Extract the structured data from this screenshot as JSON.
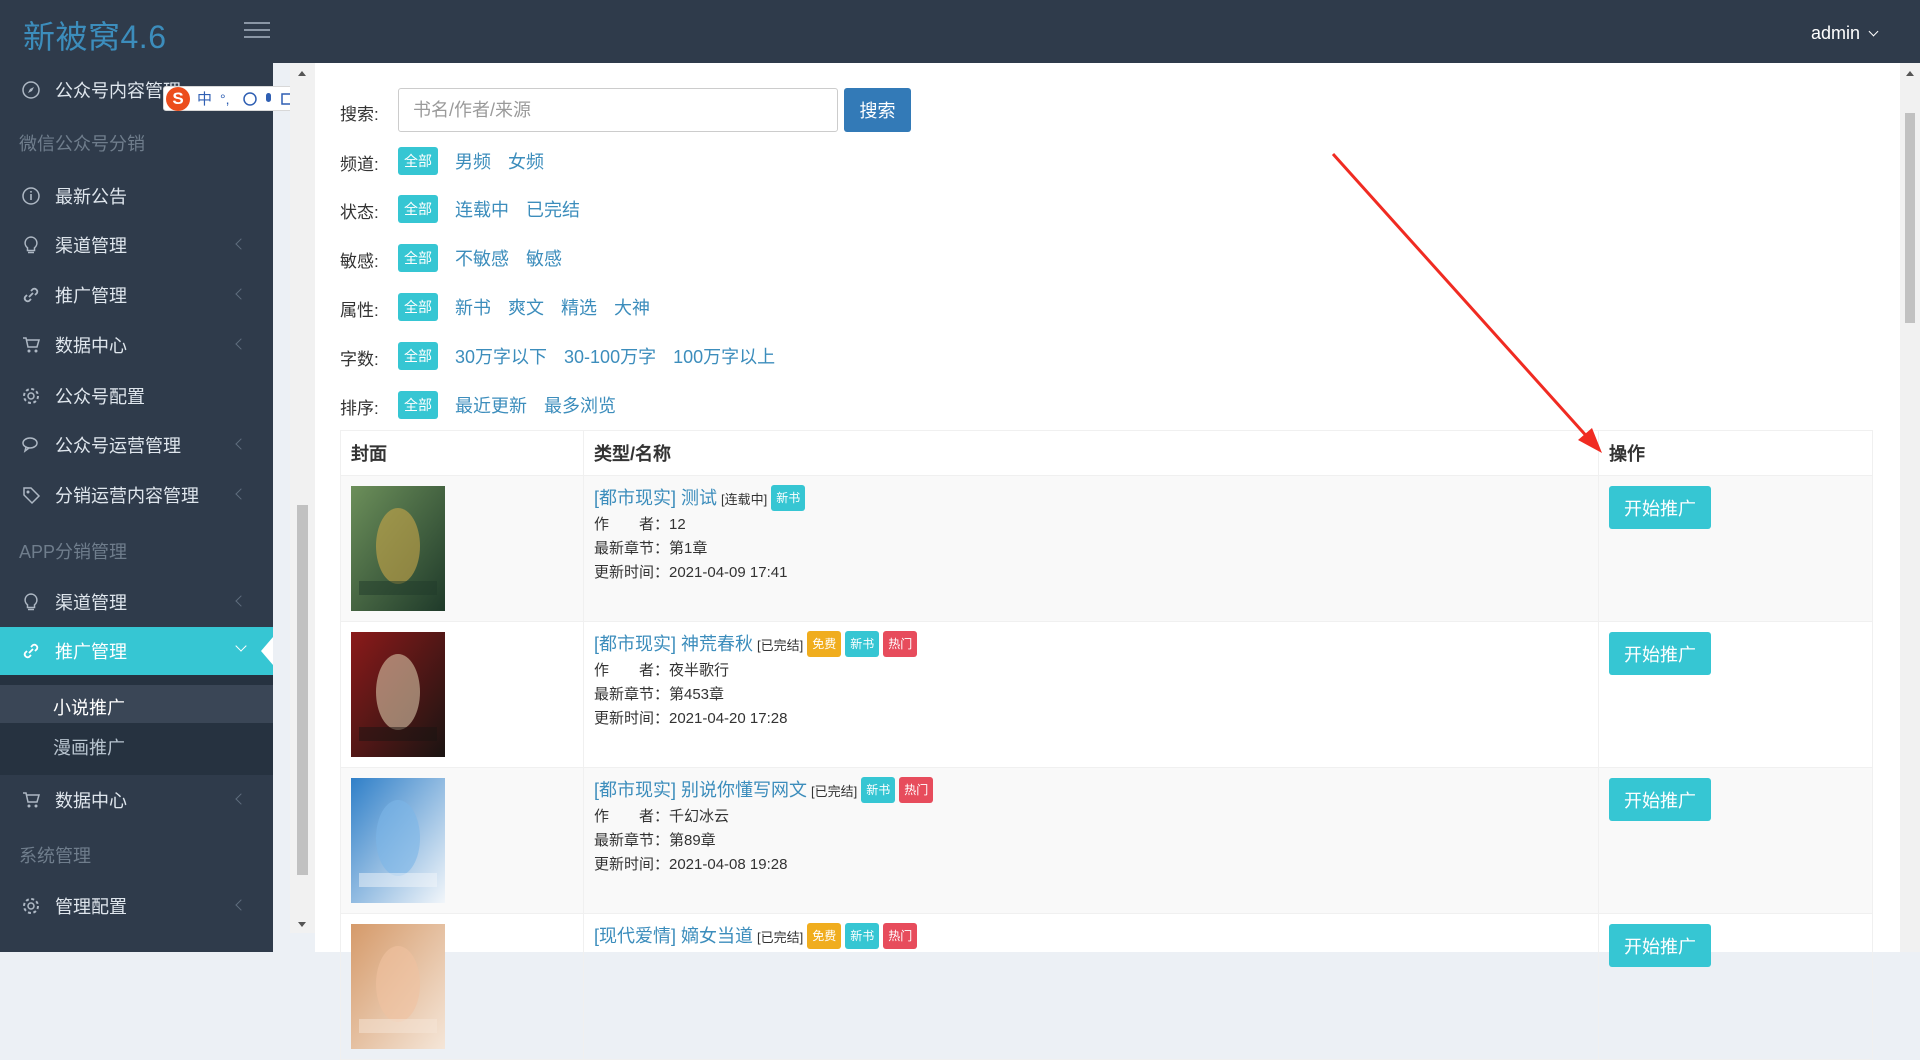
{
  "app": {
    "brand": "新被窝4.6",
    "user": "admin"
  },
  "sidebar": {
    "top_item": "公众号内容管理",
    "section_wechat": "微信公众号分销",
    "wechat_items": [
      {
        "label": "最新公告",
        "icon": "info-circle-icon"
      },
      {
        "label": "渠道管理",
        "icon": "lightbulb-icon"
      },
      {
        "label": "推广管理",
        "icon": "link-icon"
      },
      {
        "label": "数据中心",
        "icon": "cart-icon"
      },
      {
        "label": "公众号配置",
        "icon": "gear-icon"
      },
      {
        "label": "公众号运营管理",
        "icon": "chat-icon"
      },
      {
        "label": "分销运营内容管理",
        "icon": "tag-icon"
      }
    ],
    "section_app": "APP分销管理",
    "app_items": [
      {
        "label": "渠道管理",
        "icon": "lightbulb-icon"
      },
      {
        "label": "推广管理",
        "icon": "link-icon"
      }
    ],
    "sub_items": [
      "小说推广",
      "漫画推广"
    ],
    "app_items2": [
      {
        "label": "数据中心",
        "icon": "cart-icon"
      }
    ],
    "section_system": "系统管理",
    "system_items": [
      {
        "label": "管理配置",
        "icon": "gear-icon"
      }
    ]
  },
  "ime": {
    "s": "S",
    "mode": "中"
  },
  "search": {
    "label": "搜索:",
    "placeholder": "书名/作者/来源",
    "button": "搜索"
  },
  "filters": [
    {
      "label": "频道:",
      "options": [
        "全部",
        "男频",
        "女频"
      ]
    },
    {
      "label": "状态:",
      "options": [
        "全部",
        "连载中",
        "已完结"
      ]
    },
    {
      "label": "敏感:",
      "options": [
        "全部",
        "不敏感",
        "敏感"
      ]
    },
    {
      "label": "属性:",
      "options": [
        "全部",
        "新书",
        "爽文",
        "精选",
        "大神"
      ]
    },
    {
      "label": "字数:",
      "options": [
        "全部",
        "30万字以下",
        "30-100万字",
        "100万字以上"
      ]
    },
    {
      "label": "排序:",
      "options": [
        "全部",
        "最近更新",
        "最多浏览"
      ]
    }
  ],
  "table": {
    "headers": [
      "封面",
      "类型/名称",
      "操作"
    ],
    "meta_labels": {
      "author": "作　　者：",
      "chapter": "最新章节：",
      "updated": "更新时间："
    },
    "action_label": "开始推广",
    "rows": [
      {
        "title": "[都市现实] 测试",
        "status": "[连载中]",
        "badges": [
          {
            "text": "新书",
            "color": "cyan"
          }
        ],
        "author": "12",
        "chapter": "第1章",
        "updated": "2021-04-09 17:41"
      },
      {
        "title": "[都市现实] 神荒春秋",
        "status": "[已完结]",
        "badges": [
          {
            "text": "免费",
            "color": "yellow"
          },
          {
            "text": "新书",
            "color": "cyan"
          },
          {
            "text": "热门",
            "color": "red"
          }
        ],
        "author": "夜半歌行",
        "chapter": "第453章",
        "updated": "2021-04-20 17:28"
      },
      {
        "title": "[都市现实] 别说你懂写网文",
        "status": "[已完结]",
        "badges": [
          {
            "text": "新书",
            "color": "cyan"
          },
          {
            "text": "热门",
            "color": "red"
          }
        ],
        "author": "千幻冰云",
        "chapter": "第89章",
        "updated": "2021-04-08 19:28"
      },
      {
        "title": "[现代爱情] 嫡女当道",
        "status": "[已完结]",
        "badges": [
          {
            "text": "免费",
            "color": "yellow"
          },
          {
            "text": "新书",
            "color": "cyan"
          },
          {
            "text": "热门",
            "color": "red"
          }
        ],
        "author": "",
        "chapter": "",
        "updated": ""
      }
    ]
  }
}
